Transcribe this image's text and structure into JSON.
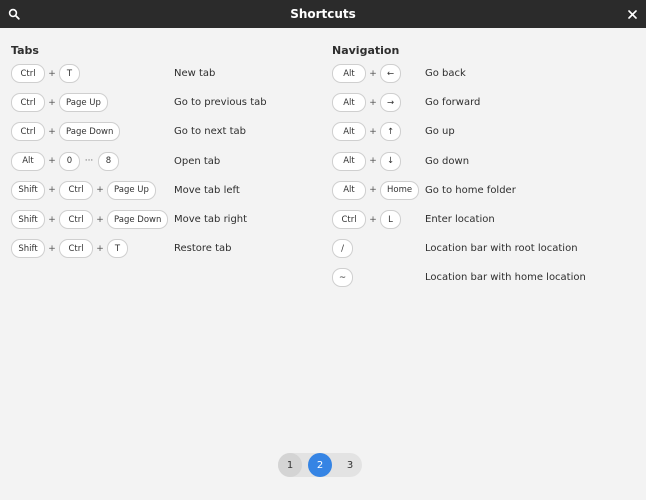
{
  "window": {
    "title": "Shortcuts",
    "search_icon": "search-icon",
    "close_icon": "close-icon"
  },
  "tabs_section": {
    "title": "Tabs",
    "rows": [
      {
        "keys": [
          "Ctrl",
          "+",
          "T"
        ],
        "desc": "New tab"
      },
      {
        "keys": [
          "Ctrl",
          "+",
          "Page Up"
        ],
        "desc": "Go to previous tab"
      },
      {
        "keys": [
          "Ctrl",
          "+",
          "Page Down"
        ],
        "desc": "Go to next tab"
      },
      {
        "keys": [
          "Alt",
          "+",
          "0",
          "···",
          "8"
        ],
        "desc": "Open tab"
      },
      {
        "keys": [
          "Shift",
          "+",
          "Ctrl",
          "+",
          "Page Up"
        ],
        "desc": "Move tab left"
      },
      {
        "keys": [
          "Shift",
          "+",
          "Ctrl",
          "+",
          "Page Down"
        ],
        "desc": "Move tab right"
      },
      {
        "keys": [
          "Shift",
          "+",
          "Ctrl",
          "+",
          "T"
        ],
        "desc": "Restore tab"
      }
    ]
  },
  "nav_section": {
    "title": "Navigation",
    "rows": [
      {
        "keys": [
          "Alt",
          "+",
          "←"
        ],
        "desc": "Go back"
      },
      {
        "keys": [
          "Alt",
          "+",
          "→"
        ],
        "desc": "Go forward"
      },
      {
        "keys": [
          "Alt",
          "+",
          "↑"
        ],
        "desc": "Go up"
      },
      {
        "keys": [
          "Alt",
          "+",
          "↓"
        ],
        "desc": "Go down"
      },
      {
        "keys": [
          "Alt",
          "+",
          "Home"
        ],
        "desc": "Go to home folder"
      },
      {
        "keys": [
          "Ctrl",
          "+",
          "L"
        ],
        "desc": "Enter location"
      },
      {
        "keys": [
          "/"
        ],
        "desc": "Location bar with root location"
      },
      {
        "keys": [
          "~"
        ],
        "desc": "Location bar with home location"
      }
    ]
  },
  "pager": {
    "pages": [
      "1",
      "2",
      "3"
    ],
    "active_index": 1,
    "accent_color": "#3584e4"
  }
}
